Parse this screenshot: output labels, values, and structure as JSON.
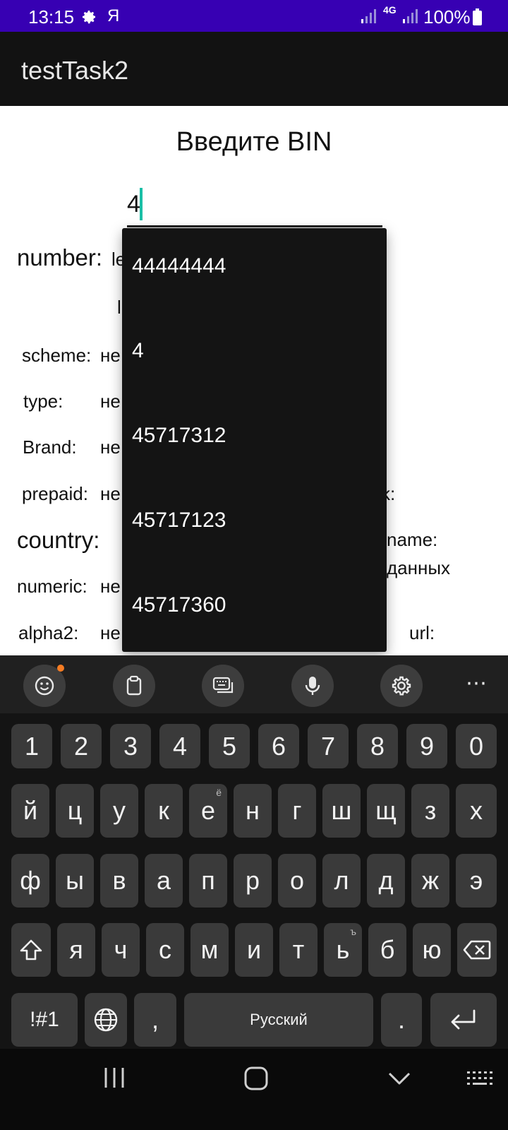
{
  "status_bar": {
    "time": "13:15",
    "extra": "Я",
    "network": "4G",
    "battery": "100%"
  },
  "app_bar": {
    "title": "testTask2"
  },
  "form": {
    "heading": "Введите BIN",
    "bin_value": "4"
  },
  "fields": {
    "number": "number:",
    "number_partial": "le",
    "number_partial2": "l",
    "scheme": "scheme:",
    "scheme_val": "не",
    "type": "type:",
    "type_val": "не",
    "brand": "Brand:",
    "brand_val": "не",
    "prepaid": "prepaid:",
    "prepaid_val": "не",
    "right_partial": "k:",
    "country": "country:",
    "name_partial": "name:",
    "data_partial": "данных",
    "numeric": "numeric:",
    "numeric_val": "не",
    "alpha2": "alpha2:",
    "alpha2_val": "не",
    "url": "url:"
  },
  "suggestions": [
    "44444444",
    "4",
    "45717312",
    "45717123",
    "45717360"
  ],
  "keyboard": {
    "toolbar": [
      "emoji-icon",
      "clipboard-icon",
      "keyboard-mode-icon",
      "microphone-icon",
      "settings-icon"
    ],
    "more": "⋯",
    "row_numbers": [
      "1",
      "2",
      "3",
      "4",
      "5",
      "6",
      "7",
      "8",
      "9",
      "0"
    ],
    "row1": [
      "й",
      "ц",
      "у",
      "к",
      "е",
      "н",
      "г",
      "ш",
      "щ",
      "з",
      "х"
    ],
    "row1_hint_e": "ё",
    "row2": [
      "ф",
      "ы",
      "в",
      "а",
      "п",
      "р",
      "о",
      "л",
      "д",
      "ж",
      "э"
    ],
    "row3": [
      "я",
      "ч",
      "с",
      "м",
      "и",
      "т",
      "ь",
      "б",
      "ю"
    ],
    "row3_hint_soft": "ъ",
    "symbols": "!#1",
    "comma": ",",
    "space": "Русский",
    "period": "."
  }
}
